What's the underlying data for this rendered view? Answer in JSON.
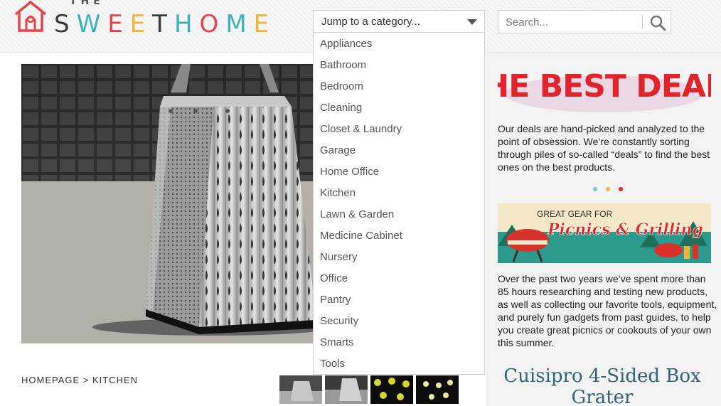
{
  "header": {
    "logo_the": "THE",
    "logo_letters": [
      "S",
      "W",
      "E",
      "E",
      "T",
      "H",
      "O",
      "M",
      "E"
    ],
    "logo_colors": [
      "#3a3a3a",
      "#3bb3b8",
      "#e7434b",
      "#f1b43b",
      "#3a3a3a",
      "#3bb3b8",
      "#e7434b",
      "#3bb3b8",
      "#f1b43b"
    ],
    "category_select": {
      "label": "Jump to a category...",
      "options": [
        "Appliances",
        "Bathroom",
        "Bedroom",
        "Cleaning",
        "Closet & Laundry",
        "Garage",
        "Home Office",
        "Kitchen",
        "Lawn & Garden",
        "Medicine Cabinet",
        "Nursery",
        "Office",
        "Pantry",
        "Security",
        "Smarts",
        "Tools"
      ]
    },
    "search": {
      "placeholder": "Search...",
      "icon": "magnifier-icon"
    }
  },
  "breadcrumb": {
    "home": "HOMEPAGE",
    "separator": ">",
    "current": "KITCHEN"
  },
  "sidebar": {
    "deals_title": "THE BEST DEALS",
    "deals_text": "Our deals are hand-picked and analyzed to the point of obsession. We’re constantly sorting through piles of so-called “deals” to find the best ones on the best products.",
    "dot_colors": [
      "#7ec8c8",
      "#f1b43b",
      "#e0242b"
    ],
    "promo_line1": "GREAT GEAR FOR",
    "promo_line2": "Picnics & Grilling",
    "promo_text": "Over the past two years we’ve spent more than 85 hours researching and testing new products, as well as collecting our favorite tools, equipment, and purely fun gadgets from past guides, to help you create great picnics or cookouts of your own this summer.",
    "product_title": "Cuisipro 4-Sided Box Grater"
  },
  "colors": {
    "accent_red": "#e7434b",
    "title_blue": "#2f6479"
  }
}
